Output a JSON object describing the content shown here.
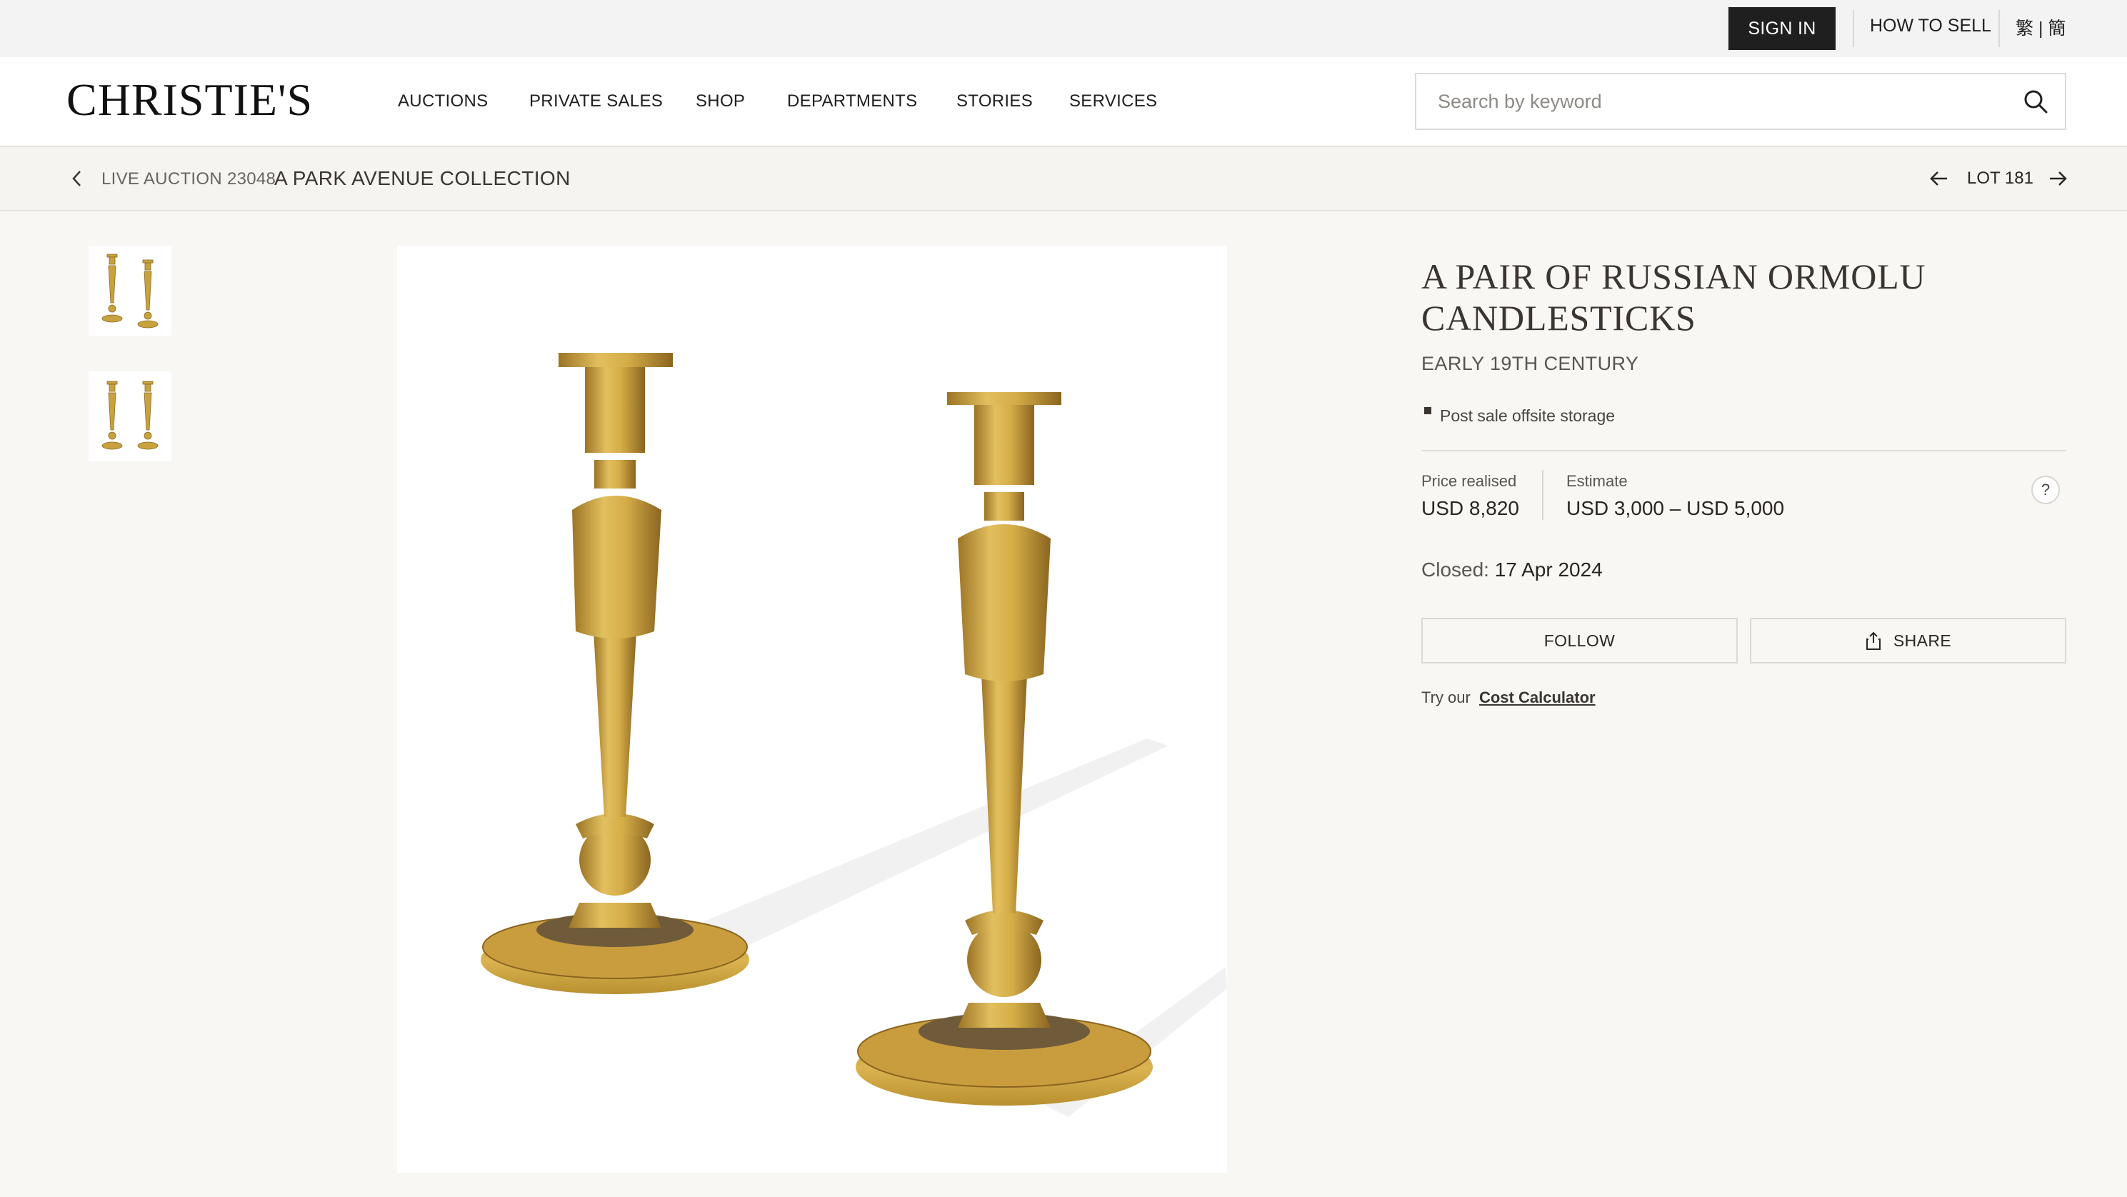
{
  "utility_bar": {
    "sign_in": "SIGN IN",
    "how_to_sell": "HOW TO SELL",
    "language": "繁 | 簡"
  },
  "header": {
    "logo": "CHRISTIE'S",
    "nav": [
      "AUCTIONS",
      "PRIVATE SALES",
      "SHOP",
      "DEPARTMENTS",
      "STORIES",
      "SERVICES"
    ],
    "search_placeholder": "Search by keyword"
  },
  "breadcrumb": {
    "sale_type": "LIVE AUCTION 23048",
    "sale_name": "A PARK AVENUE COLLECTION",
    "lot": "LOT 181"
  },
  "lot": {
    "title_line1": "A PAIR OF RUSSIAN ORMOLU",
    "title_line2": "CANDLESTICKS",
    "subtitle": "EARLY 19TH CENTURY",
    "note": "Post sale offsite storage",
    "price_realised_label": "Price realised",
    "price_realised_value": "USD 8,820",
    "estimate_label": "Estimate",
    "estimate_value": "USD 3,000 – USD 5,000",
    "help": "?",
    "closed_label": "Closed:",
    "closed_date": "17 Apr 2024",
    "follow": "FOLLOW",
    "share": "SHARE",
    "calc_prefix": "Try our",
    "calc_link": "Cost Calculator"
  },
  "colors": {
    "page_bg": "#f8f7f4",
    "button_dark": "#1f1f1f",
    "ormolu_gold": "#c9a240",
    "text_primary": "#2a2520"
  },
  "icons": [
    "search-icon",
    "chevron-left-icon",
    "arrow-left-icon",
    "arrow-right-icon",
    "share-icon"
  ]
}
